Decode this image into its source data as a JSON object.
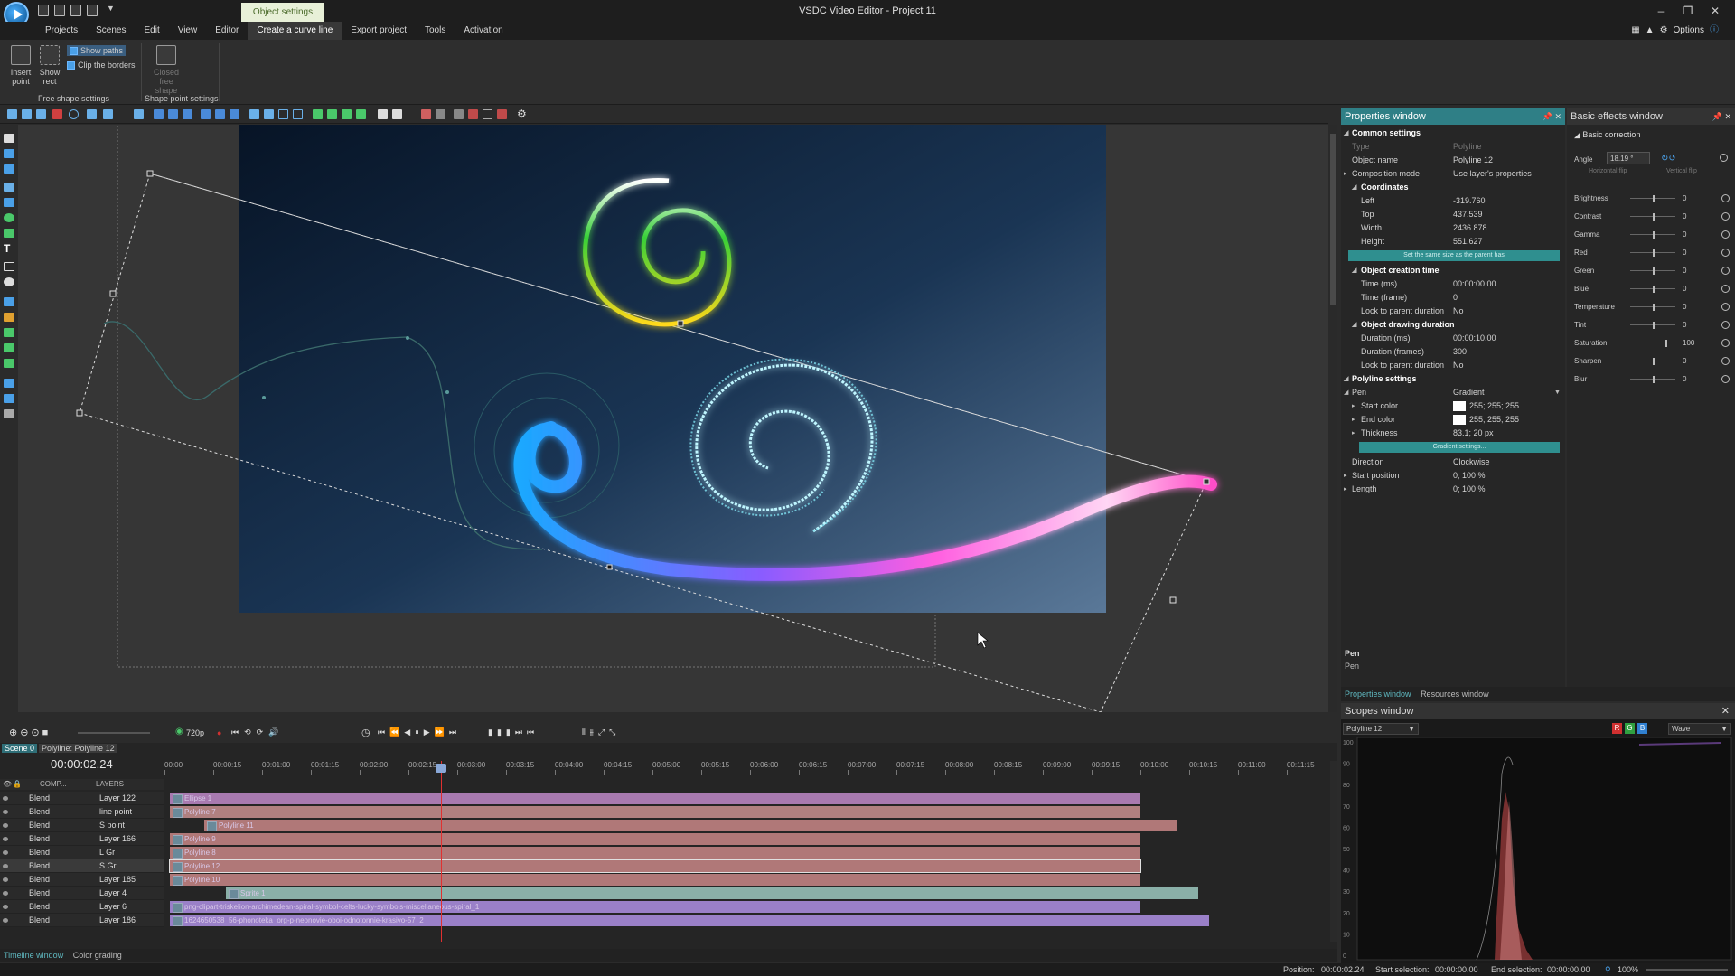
{
  "window": {
    "title": "VSDC Video Editor - Project 11",
    "context_tab": "Object settings"
  },
  "menu": [
    "Projects",
    "Scenes",
    "Edit",
    "View",
    "Editor",
    "Create a curve line",
    "Export project",
    "Tools",
    "Activation"
  ],
  "menu_active_index": 5,
  "options_label": "Options",
  "ribbon": {
    "insert_point": "Insert point",
    "show_rect": "Show rect",
    "show_paths": "Show paths",
    "clip_borders": "Clip the borders",
    "free_shape_settings": "Free shape settings",
    "closed_free_shape": "Closed free shape",
    "shape_point_settings": "Shape point settings"
  },
  "properties": {
    "title": "Properties window",
    "common_settings": "Common settings",
    "type_label": "Type",
    "type_value": "Polyline",
    "object_name_label": "Object name",
    "object_name_value": "Polyline 12",
    "composition_mode_label": "Composition mode",
    "composition_mode_value": "Use layer's properties",
    "coordinates": "Coordinates",
    "left_label": "Left",
    "left_value": "-319.760",
    "top_label": "Top",
    "top_value": "437.539",
    "width_label": "Width",
    "width_value": "2436.878",
    "height_label": "Height",
    "height_value": "551.627",
    "same_size_btn": "Set the same size as the parent has",
    "creation_time": "Object creation time",
    "time_ms_label": "Time (ms)",
    "time_ms_value": "00:00:00.00",
    "time_frame_label": "Time (frame)",
    "time_frame_value": "0",
    "lock_parent_label": "Lock to parent duration",
    "lock_parent_value": "No",
    "drawing_duration": "Object drawing duration",
    "duration_ms_label": "Duration (ms)",
    "duration_ms_value": "00:00:10.00",
    "duration_frames_label": "Duration (frames)",
    "duration_frames_value": "300",
    "lock_parent2_label": "Lock to parent duration",
    "lock_parent2_value": "No",
    "polyline_settings": "Polyline settings",
    "pen_label": "Pen",
    "pen_value": "Gradient",
    "start_color_label": "Start color",
    "start_color_value": "255; 255; 255",
    "end_color_label": "End color",
    "end_color_value": "255; 255; 255",
    "thickness_label": "Thickness",
    "thickness_value": "83.1; 20 px",
    "gradient_btn": "Gradient settings...",
    "direction_label": "Direction",
    "direction_value": "Clockwise",
    "start_position_label": "Start position",
    "start_position_value": "0; 100 %",
    "length_label": "Length",
    "length_value": "0; 100 %",
    "caption_title": "Pen",
    "caption_desc": "Pen"
  },
  "effects": {
    "title": "Basic effects window",
    "basic_correction": "Basic correction",
    "angle_label": "Angle",
    "angle_value": "18.19 °",
    "horizontal_flip": "Horizontal flip",
    "vertical_flip": "Vertical flip",
    "rows": [
      {
        "label": "Brightness",
        "value": "0"
      },
      {
        "label": "Contrast",
        "value": "0"
      },
      {
        "label": "Gamma",
        "value": "0"
      },
      {
        "label": "Red",
        "value": "0"
      },
      {
        "label": "Green",
        "value": "0"
      },
      {
        "label": "Blue",
        "value": "0"
      },
      {
        "label": "Temperature",
        "value": "0"
      },
      {
        "label": "Tint",
        "value": "0"
      },
      {
        "label": "Saturation",
        "value": "100"
      },
      {
        "label": "Sharpen",
        "value": "0"
      },
      {
        "label": "Blur",
        "value": "0"
      }
    ]
  },
  "panel_tabs": {
    "properties": "Properties window",
    "resources": "Resources window"
  },
  "scopes": {
    "title": "Scopes window",
    "object": "Polyline 12",
    "r": "R",
    "g": "G",
    "b": "B",
    "mode": "Wave",
    "scale": [
      "100",
      "90",
      "80",
      "70",
      "60",
      "50",
      "40",
      "30",
      "20",
      "10",
      "0"
    ]
  },
  "timeline": {
    "scene_tab": "Scene 0",
    "object_tab": "Polyline: Polyline 12",
    "timecode": "00:00:02.24",
    "quality": "720p",
    "comp_label": "COMP...",
    "layers_label": "LAYERS",
    "ticks": [
      "00:00",
      "00:00:15",
      "00:01:00",
      "00:01:15",
      "00:02:00",
      "00:02:15",
      "00:03:00",
      "00:03:15",
      "00:04:00",
      "00:04:15",
      "00:05:00",
      "00:05:15",
      "00:06:00",
      "00:06:15",
      "00:07:00",
      "00:07:15",
      "00:08:00",
      "00:08:15",
      "00:09:00",
      "00:09:15",
      "00:10:00",
      "00:10:15",
      "00:11:00",
      "00:11:15"
    ],
    "rows": [
      {
        "blend": "Blend",
        "layer": "Layer 122",
        "clip": "Ellipse 1"
      },
      {
        "blend": "Blend",
        "layer": "line point",
        "clip": "Polyline 7"
      },
      {
        "blend": "Blend",
        "layer": "S point",
        "clip": "Polyline 11"
      },
      {
        "blend": "Blend",
        "layer": "Layer 166",
        "clip": "Polyline 9"
      },
      {
        "blend": "Blend",
        "layer": "L Gr",
        "clip": "Polyline 8"
      },
      {
        "blend": "Blend",
        "layer": "S Gr",
        "clip": "Polyline 12"
      },
      {
        "blend": "Blend",
        "layer": "Layer 185",
        "clip": "Polyline 10"
      },
      {
        "blend": "Blend",
        "layer": "Layer 4",
        "clip": "Sprite 1"
      },
      {
        "blend": "Blend",
        "layer": "Layer 6",
        "clip": "png-clipart-triskelion-archimedean-spiral-symbol-celts-lucky-symbols-miscellaneous-spiral_1"
      },
      {
        "blend": "Blend",
        "layer": "Layer 186",
        "clip": "1624650538_56-phonoteka_org-p-neonovie-oboi-odnotonnie-krasivo-57_2"
      }
    ]
  },
  "bottom_tabs": {
    "timeline": "Timeline window",
    "color": "Color grading"
  },
  "status": {
    "position_label": "Position:",
    "position_value": "00:00:02.24",
    "start_sel_label": "Start selection:",
    "start_sel_value": "00:00:00.00",
    "end_sel_label": "End selection:",
    "end_sel_value": "00:00:00.00",
    "zoom": "100%"
  }
}
